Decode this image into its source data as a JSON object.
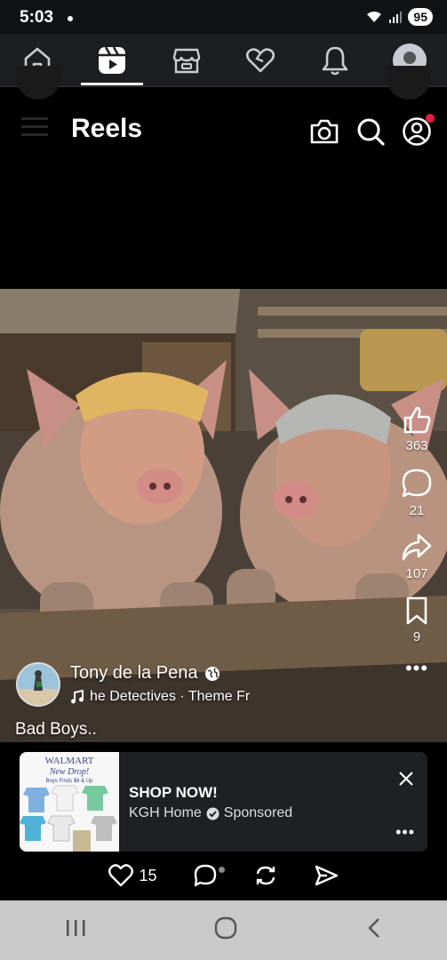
{
  "status_bar": {
    "time": "5:03",
    "battery": "95"
  },
  "top_nav": {
    "items": [
      {
        "icon": "home-icon"
      },
      {
        "icon": "reels-icon",
        "active": true
      },
      {
        "icon": "marketplace-icon"
      },
      {
        "icon": "dating-heart-icon"
      },
      {
        "icon": "bell-icon"
      },
      {
        "icon": "profile-avatar"
      }
    ]
  },
  "header": {
    "title": "Reels"
  },
  "actions": {
    "likes": "363",
    "comments": "21",
    "shares": "107",
    "saves": "9"
  },
  "author": {
    "name": "Tony de la Pena",
    "audio": "he Detectives · Theme Fr",
    "caption": "Bad Boys.."
  },
  "ad": {
    "cta": "SHOP NOW!",
    "advertiser": "KGH Home",
    "sponsored": "Sponsored",
    "thumb_brand": "WALMART",
    "thumb_line1": "New Drop!",
    "thumb_line2": "Boys Finds $6 & Up"
  },
  "bottom": {
    "likes": "15"
  },
  "colors": {
    "accent_red": "#e41e3f",
    "nav_bg": "#1c1e21",
    "card_bg": "#1e2023"
  }
}
